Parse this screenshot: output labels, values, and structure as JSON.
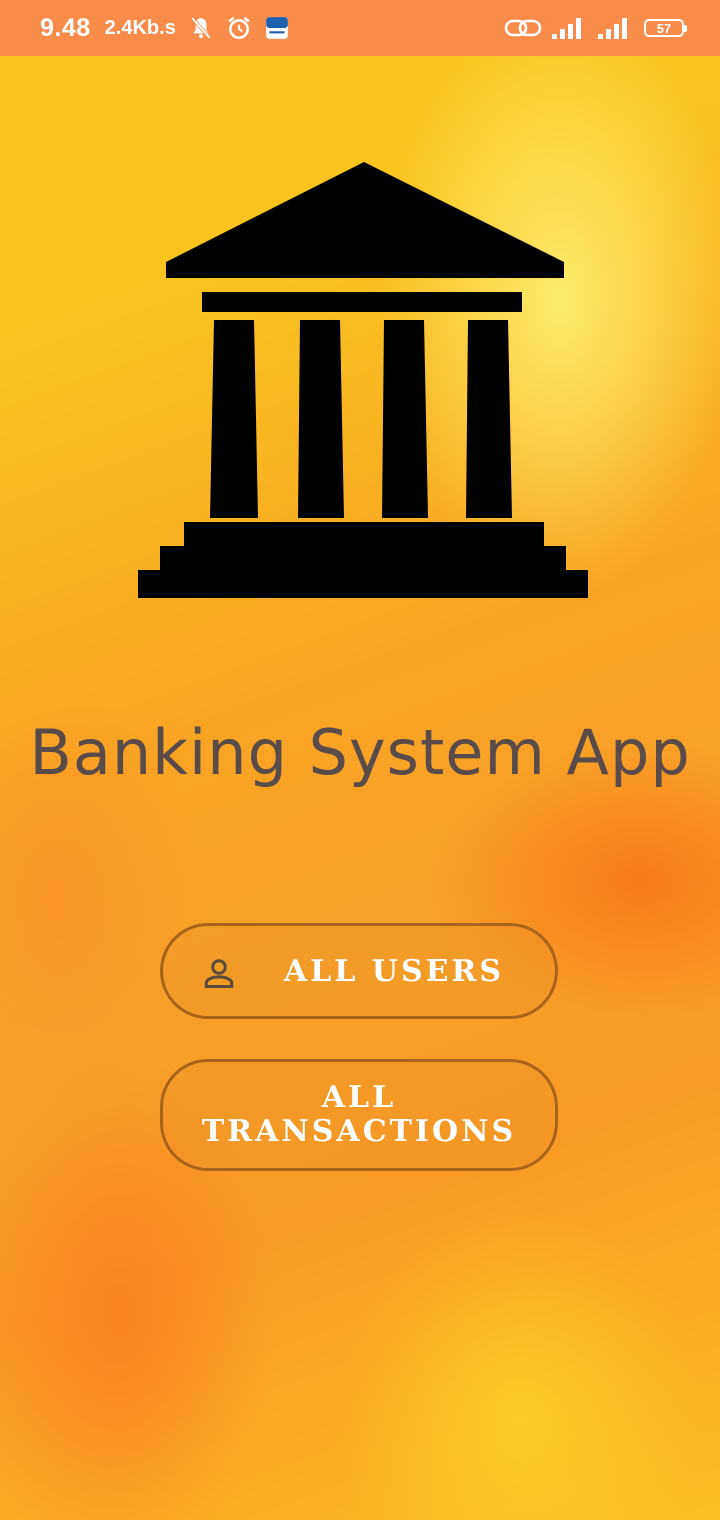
{
  "status_bar": {
    "time": "9.48",
    "speed": "2.4Kb.s",
    "battery": "57",
    "icons": [
      "bell-off-icon",
      "alarm-icon",
      "notification-app-icon",
      "link-icon",
      "signal-icon",
      "signal-icon",
      "battery-icon"
    ]
  },
  "logo": {
    "icon": "bank-building-icon"
  },
  "app": {
    "title": "Banking System App"
  },
  "buttons": {
    "all_users": {
      "label": "ALL USERS",
      "icon": "person-icon"
    },
    "all_transactions": {
      "line1": "ALL",
      "line2": "TRANSACTIONS"
    }
  },
  "colors": {
    "status_bar": "#f98c4a",
    "background": "#f7a21f",
    "title_text": "#5a4a4a",
    "button_border": "#a7651b",
    "button_text": "#ffffff"
  }
}
